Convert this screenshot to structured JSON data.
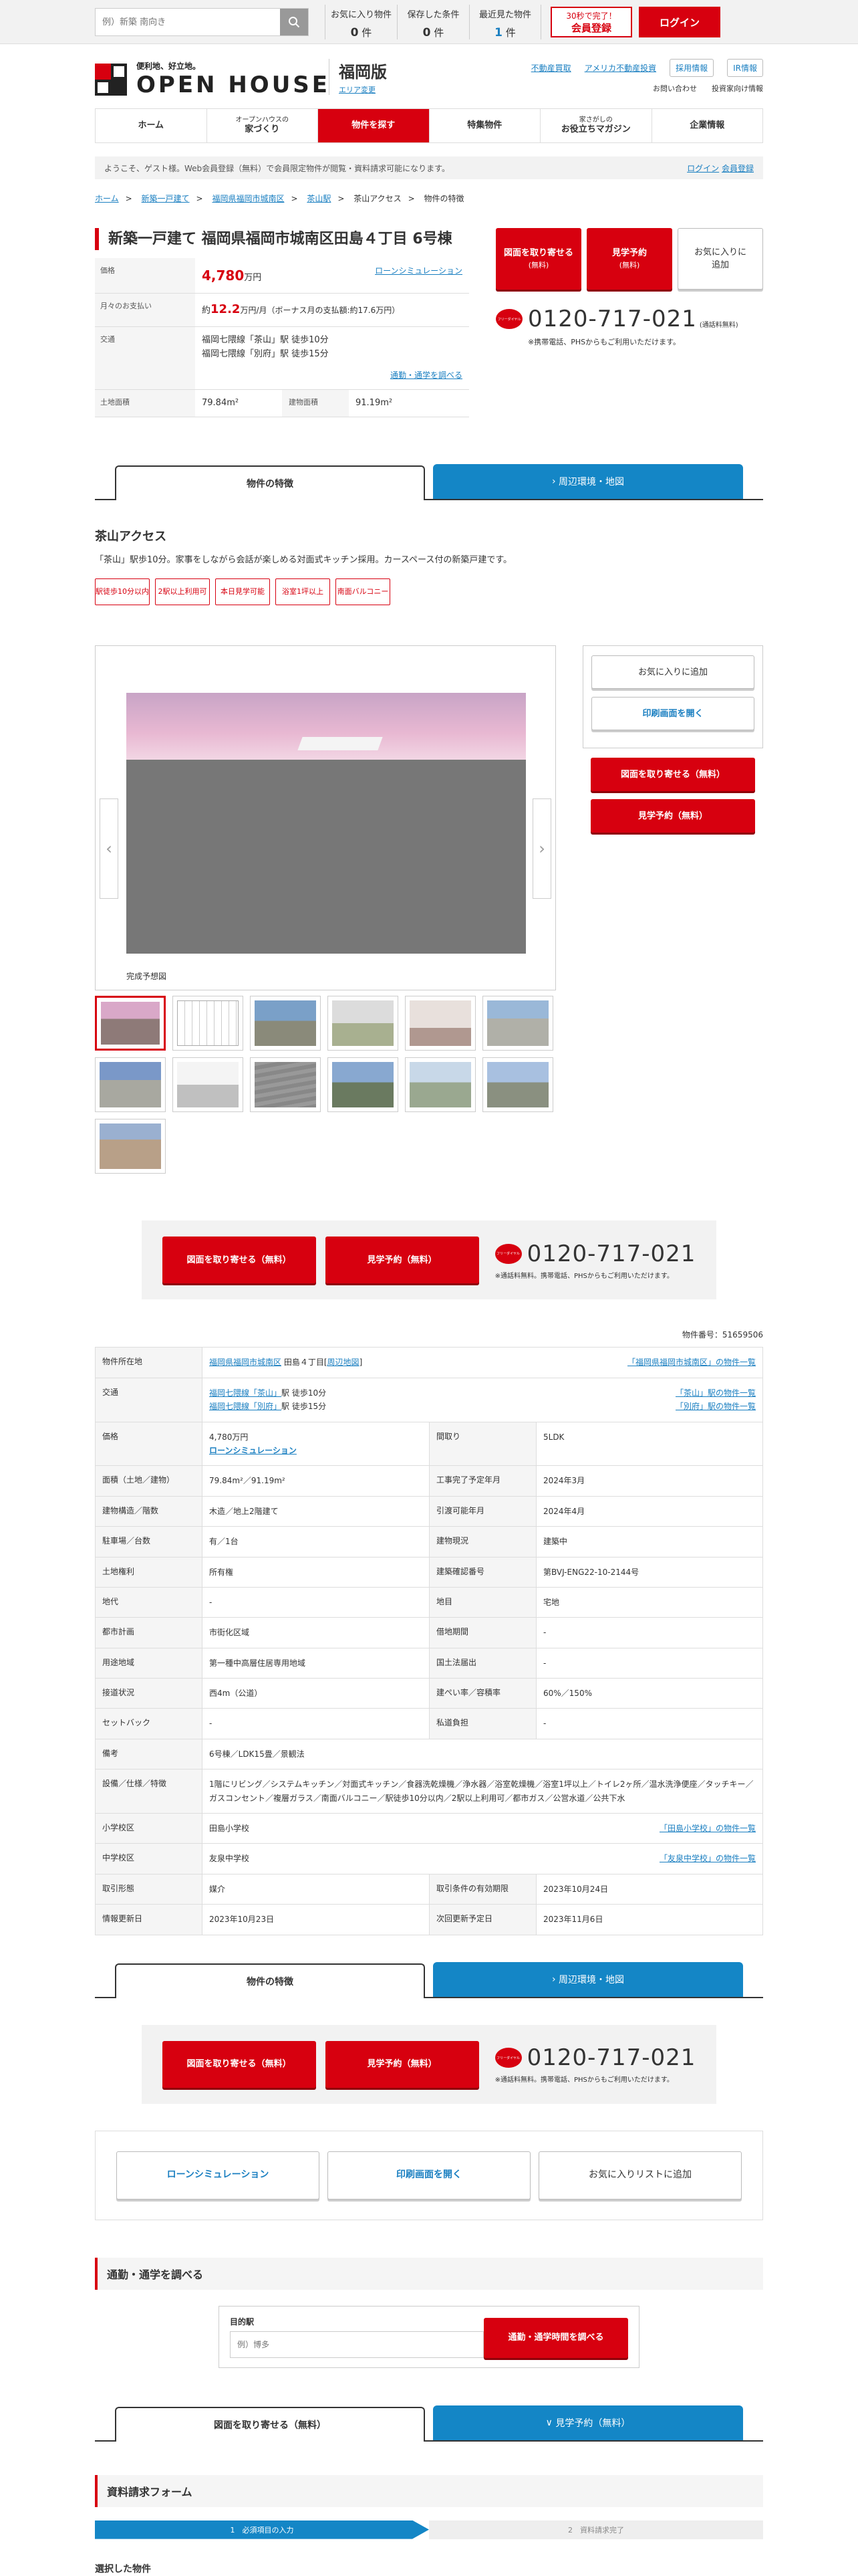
{
  "topbar": {
    "search_placeholder": "例）新築 南向き",
    "counters": [
      {
        "label": "お気に入り物件",
        "value": "0",
        "unit": "件"
      },
      {
        "label": "保存した条件",
        "value": "0",
        "unit": "件"
      },
      {
        "label": "最近見た物件",
        "value": "1",
        "unit": "件"
      }
    ],
    "member_small": "30秒で完了！",
    "member_big": "会員登録",
    "login": "ログイン"
  },
  "header": {
    "tagline": "便利地、好立地。",
    "brand": "OPEN HOUSE",
    "area": "福岡版",
    "area_change": "エリア変更",
    "links": [
      "不動産買取",
      "アメリカ不動産投資",
      "採用情報",
      "IR情報"
    ],
    "sub_links": [
      "お問い合わせ",
      "投資家向け情報"
    ]
  },
  "gnav": [
    {
      "small": "",
      "label": "ホーム"
    },
    {
      "small": "オープンハウスの",
      "label": "家づくり"
    },
    {
      "small": "",
      "label": "物件を探す"
    },
    {
      "small": "",
      "label": "特集物件"
    },
    {
      "small": "家さがしの",
      "label": "お役立ちマガジン"
    },
    {
      "small": "",
      "label": "企業情報"
    }
  ],
  "welcome": {
    "text": "ようこそ、ゲスト様。Web会員登録（無料）で会員限定物件が閲覧・資料請求可能になります。",
    "login": "ログイン",
    "register": "会員登録"
  },
  "breadcrumb": [
    "ホーム",
    "新築一戸建て",
    "福岡県福岡市城南区",
    "茶山駅",
    "茶山アクセス",
    "物件の特徴"
  ],
  "title": "新築一戸建て 福岡県福岡市城南区田島４丁目 6号棟",
  "summary": {
    "price_label": "価格",
    "price_value": "4,780",
    "price_unit": "万円",
    "loan_sim": "ローンシミュレーション",
    "monthly_label": "月々のお支払い",
    "monthly_prefix": "約",
    "monthly_value": "12.2",
    "monthly_suffix": "万円/月（ボーナス月の支払額:約17.6万円）",
    "traffic_label": "交通",
    "traffic_1": "福岡七隈線「茶山」駅 徒歩10分",
    "traffic_2": "福岡七隈線「別府」駅 徒歩15分",
    "commute_link": "通勤・通学を調べる",
    "land_label": "土地面積",
    "land_value": "79.84m²",
    "building_label": "建物面積",
    "building_value": "91.19m²"
  },
  "actions": {
    "request": "図面を取り寄せる",
    "request_sub": "(無料)",
    "visit": "見学予約",
    "visit_sub": "(無料)",
    "favorite": "お気に入りに追加",
    "tel": "0120-717-021",
    "tel_free": "(通話料無料)",
    "tel_note": "※携帯電話、PHSからもご利用いただけます。",
    "tel_note2": "※通話料無料。携帯電話、PHSからもご利用いただけます。",
    "tel_icon": "フリーダイヤル"
  },
  "tabs": {
    "features": "物件の特徴",
    "surroundings": "周辺環境・地図",
    "request": "図面を取り寄せる（無料）",
    "visit": "見学予約（無料）"
  },
  "catch": {
    "title": "茶山アクセス",
    "text": "「茶山」駅歩10分。家事をしながら会話が楽しめる対面式キッチン採用。カースペース付の新築戸建です。",
    "tags": [
      "駅徒歩10分以内",
      "2駅以上利用可",
      "本日見学可能",
      "浴室1坪以上",
      "南面バルコニー"
    ]
  },
  "gallery": {
    "caption": "完成予想図",
    "side_favorite": "お気に入りに追加",
    "side_print": "印刷画面を開く",
    "side_request": "図面を取り寄せる（無料）",
    "side_visit": "見学予約（無料）"
  },
  "detail": {
    "prop_no": "物件番号：51659506",
    "rows": {
      "location_label": "物件所在地",
      "location_link": "福岡県福岡市城南区",
      "location_rest": "田島４丁目",
      "location_map": "周辺地図",
      "location_list": "「福岡県福岡市城南区」の物件一覧",
      "traffic_label": "交通",
      "traffic_1a": "福岡七隈線",
      "traffic_1b": "「茶山」",
      "traffic_1c": "駅 徒歩10分",
      "traffic_2a": "福岡七隈線",
      "traffic_2b": "「別府」",
      "traffic_2c": "駅 徒歩15分",
      "traffic_list_1": "「茶山」駅の物件一覧",
      "traffic_list_2": "「別府」駅の物件一覧",
      "price_label": "価格",
      "price_value": "4,780万円",
      "price_loan": "ローンシミュレーション",
      "layout_label": "間取り",
      "layout_value": "5LDK",
      "area_label": "面積（土地／建物）",
      "area_value": "79.84m²／91.19m²",
      "complete_label": "工事完了予定年月",
      "complete_value": "2024年3月",
      "structure_label": "建物構造／階数",
      "structure_value": "木造／地上2階建て",
      "handover_label": "引渡可能年月",
      "handover_value": "2024年4月",
      "parking_label": "駐車場／台数",
      "parking_value": "有／1台",
      "status_label": "建物現況",
      "status_value": "建築中",
      "right_label": "土地権利",
      "right_value": "所有権",
      "confirm_label": "建築確認番号",
      "confirm_value": "第BVJ-ENG22-10-2144号",
      "fee_label": "地代",
      "fee_value": "-",
      "landcat_label": "地目",
      "landcat_value": "宅地",
      "plan_label": "都市計画",
      "plan_value": "市街化区域",
      "lease_label": "借地期間",
      "lease_value": "-",
      "zone_label": "用途地域",
      "zone_value": "第一種中高層住居専用地域",
      "notify_label": "国土法届出",
      "notify_value": "-",
      "road_label": "接道状況",
      "road_value": "西4m（公道）",
      "ratio_label": "建ぺい率／容積率",
      "ratio_value": "60%／150%",
      "setback_label": "セットバック",
      "setback_value": "-",
      "private_label": "私道負担",
      "private_value": "-",
      "remarks_label": "備考",
      "remarks_value": "6号棟／LDK15畳／景観法",
      "equip_label": "設備／仕様／特徴",
      "equip_value": "1階にリビング／システムキッチン／対面式キッチン／食器洗乾燥機／浄水器／浴室乾燥機／浴室1坪以上／トイレ2ヶ所／温水洗浄便座／タッチキー／ガスコンセント／複層ガラス／南面バルコニー／駅徒歩10分以内／2駅以上利用可／都市ガス／公営水道／公共下水",
      "elementary_label": "小学校区",
      "elementary_value": "田島小学校",
      "elementary_list": "「田島小学校」の物件一覧",
      "junior_label": "中学校区",
      "junior_value": "友泉中学校",
      "junior_list": "「友泉中学校」の物件一覧",
      "deal_label": "取引形態",
      "deal_value": "媒介",
      "deal_expire_label": "取引条件の有効期限",
      "deal_expire_value": "2023年10月24日",
      "info_label": "情報更新日",
      "info_value": "2023年10月23日",
      "next_label": "次回更新予定日",
      "next_value": "2023年11月6日"
    }
  },
  "bottom": {
    "loan": "ローンシミュレーション",
    "print": "印刷画面を開く",
    "favorite_list": "お気に入りリストに追加"
  },
  "commute": {
    "title": "通勤・通学を調べる",
    "label": "目的駅",
    "placeholder": "例）博多",
    "button": "通勤・通学時間を調べる"
  },
  "form": {
    "title": "資料請求フォーム",
    "step1": "1　必須項目の入力",
    "step2": "2　資料請求完了",
    "selected": "選択した物件"
  },
  "colors": {
    "brand_red": "#d7000f",
    "tab_blue": "#1486c6"
  }
}
